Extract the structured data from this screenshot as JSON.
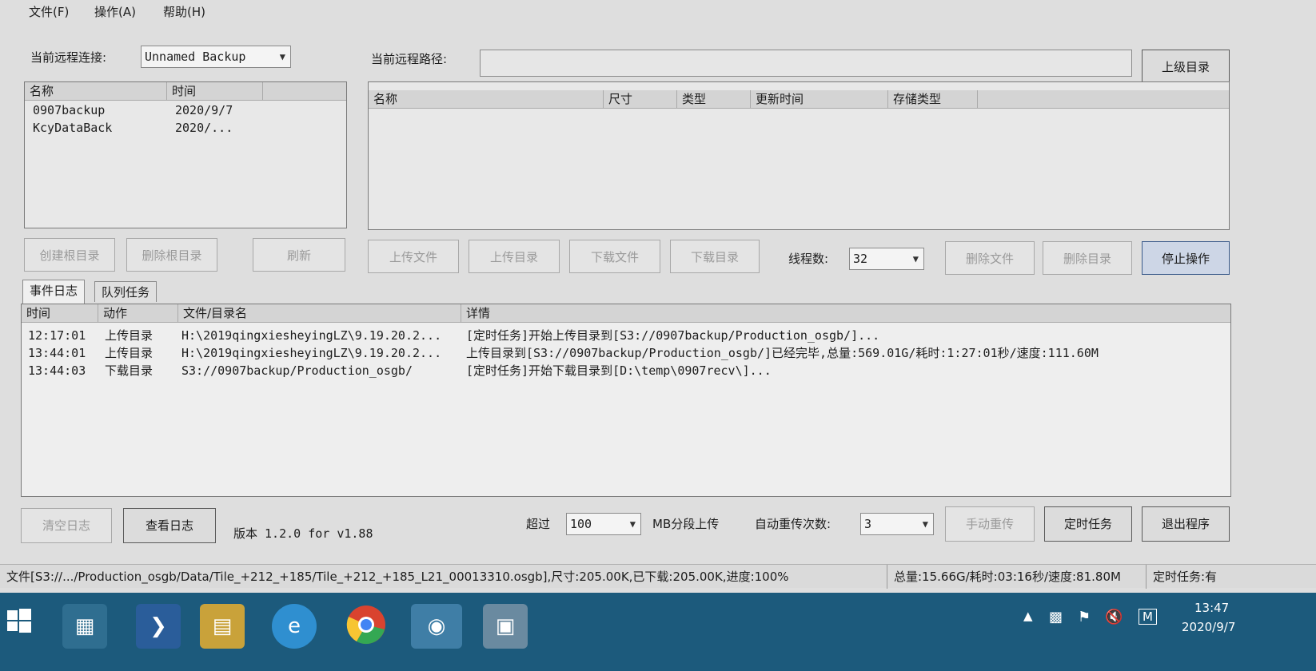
{
  "menu": {
    "file": "文件(F)",
    "action": "操作(A)",
    "help": "帮助(H)"
  },
  "remote": {
    "conn_label": "当前远程连接:",
    "conn_value": "Unnamed Backup",
    "path_label": "当前远程路径:",
    "path_value": "",
    "parent_dir_btn": "上级目录"
  },
  "buckets": {
    "headers": [
      "名称",
      "时间"
    ],
    "rows": [
      {
        "name": "0907backup",
        "time": "2020/9/7"
      },
      {
        "name": "KcyDataBack",
        "time": "2020/..."
      }
    ]
  },
  "files": {
    "headers": [
      "名称",
      "尺寸",
      "类型",
      "更新时间",
      "存储类型"
    ]
  },
  "buttons": {
    "create_root": "创建根目录",
    "delete_root": "删除根目录",
    "refresh": "刷新",
    "upload_file": "上传文件",
    "upload_dir": "上传目录",
    "download_file": "下载文件",
    "download_dir": "下载目录",
    "threads_label": "线程数:",
    "threads_value": "32",
    "delete_file": "删除文件",
    "delete_dir": "删除目录",
    "stop": "停止操作"
  },
  "tabs": {
    "events": "事件日志",
    "queue": "队列任务"
  },
  "log": {
    "headers": [
      "时间",
      "动作",
      "文件/目录名",
      "详情"
    ],
    "rows": [
      {
        "time": "12:17:01",
        "action": "上传目录",
        "name": "H:\\2019qingxiesheyingLZ\\9.19.20.2...",
        "detail": "[定时任务]开始上传目录到[S3://0907backup/Production_osgb/]..."
      },
      {
        "time": "13:44:01",
        "action": "上传目录",
        "name": "H:\\2019qingxiesheyingLZ\\9.19.20.2...",
        "detail": "上传目录到[S3://0907backup/Production_osgb/]已经完毕,总量:569.01G/耗时:1:27:01秒/速度:111.60M"
      },
      {
        "time": "13:44:03",
        "action": "下载目录",
        "name": "S3://0907backup/Production_osgb/",
        "detail": "[定时任务]开始下载目录到[D:\\temp\\0907recv\\]..."
      }
    ]
  },
  "bottom": {
    "clear_log": "清空日志",
    "view_log": "查看日志",
    "version": "版本 1.2.0 for v1.88",
    "exceed_label": "超过",
    "exceed_value": "100",
    "segment_label": "MB分段上传",
    "retry_label": "自动重传次数:",
    "retry_value": "3",
    "manual_retry": "手动重传",
    "scheduled_task": "定时任务",
    "exit": "退出程序"
  },
  "status": {
    "file": "文件[S3://.../Production_osgb/Data/Tile_+212_+185/Tile_+212_+185_L21_00013310.osgb],尺寸:205.00K,已下载:205.00K,进度:100%",
    "total": "总量:15.66G/耗时:03:16秒/速度:81.80M",
    "task": "定时任务:有"
  },
  "taskbar": {
    "time": "13:47",
    "date": "2020/9/7",
    "ime": "M"
  }
}
